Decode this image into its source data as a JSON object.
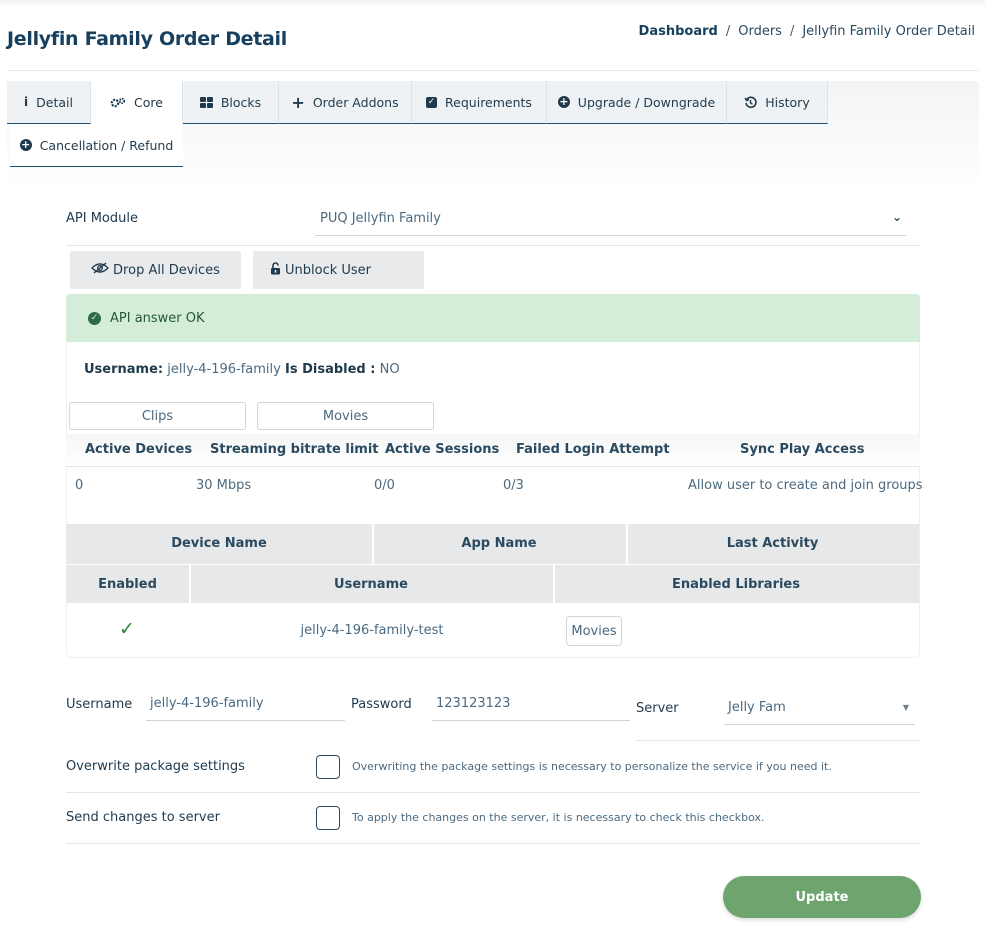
{
  "page": {
    "title": "Jellyfin Family Order Detail"
  },
  "breadcrumb": {
    "items": [
      "Dashboard",
      "Orders",
      "Jellyfin Family Order Detail"
    ],
    "separator": "/"
  },
  "tabs": [
    {
      "label": "Detail",
      "icon": "info-icon"
    },
    {
      "label": "Core",
      "icon": "gears-icon"
    },
    {
      "label": "Blocks",
      "icon": "grid-icon"
    },
    {
      "label": "Order Addons",
      "icon": "plus-icon"
    },
    {
      "label": "Requirements",
      "icon": "check-square-icon"
    },
    {
      "label": "Upgrade / Downgrade",
      "icon": "plus-circle-icon"
    },
    {
      "label": "History",
      "icon": "history-icon"
    },
    {
      "label": "Cancellation / Refund",
      "icon": "plus-circle-icon"
    }
  ],
  "active_tab": "Core",
  "api_module": {
    "label": "API Module",
    "value": "PUQ Jellyfin Family"
  },
  "actions": {
    "drop_devices": "Drop All Devices",
    "unblock_user": "Unblock User"
  },
  "alert": {
    "text": "API answer OK"
  },
  "user_info": {
    "username_label": "Username:",
    "username": "jelly-4-196-family",
    "disabled_label": "Is Disabled :",
    "disabled": "NO"
  },
  "library_buttons": [
    "Clips",
    "Movies"
  ],
  "stats": {
    "headers": [
      "Active Devices",
      "Streaming bitrate limit",
      "Active Sessions",
      "Failed Login Attempt",
      "Sync Play Access"
    ],
    "values": [
      "0",
      "30 Mbps",
      "0/0",
      "0/3",
      "Allow user to create and join groups"
    ]
  },
  "devices": {
    "headers": [
      "Device Name",
      "App Name",
      "Last Activity"
    ]
  },
  "users_table": {
    "headers": [
      "Enabled",
      "Username",
      "Enabled Libraries"
    ],
    "rows": [
      {
        "enabled": "✓",
        "username": "jelly-4-196-family-test",
        "library": "Movies"
      }
    ]
  },
  "form": {
    "username_label": "Username",
    "username_value": "jelly-4-196-family",
    "password_label": "Password",
    "password_value": "123123123",
    "server_label": "Server",
    "server_value": "Jelly Fam",
    "overwrite_label": "Overwrite package settings",
    "overwrite_hint": "Overwriting the package settings is necessary to personalize the service if you need it.",
    "send_label": "Send changes to server",
    "send_hint": "To apply the changes on the server, it is necessary to check this checkbox.",
    "update_label": "Update"
  },
  "colors": {
    "primary_text": "#16405e",
    "alert_bg": "#d4edd9",
    "update_button": "#6ea56e",
    "check_green": "#2a8a3a"
  }
}
